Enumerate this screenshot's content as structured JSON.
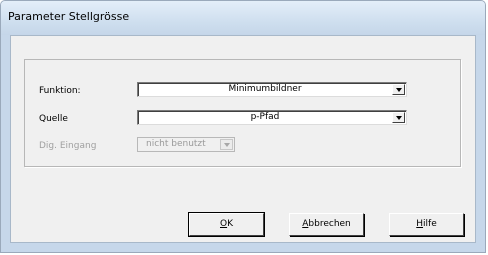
{
  "window": {
    "title": "Parameter Stellgrösse"
  },
  "form": {
    "function_label": "Funktion:",
    "function_value": "Minimumbildner",
    "source_label": "Quelle",
    "source_value": "p-Pfad",
    "digital_input_label": "Dig. Eingang",
    "digital_input_value": "nicht benutzt"
  },
  "buttons": {
    "ok_accel": "O",
    "ok_rest": "K",
    "cancel_accel": "A",
    "cancel_rest": "bbrechen",
    "help_accel": "H",
    "help_rest": "ilfe"
  }
}
